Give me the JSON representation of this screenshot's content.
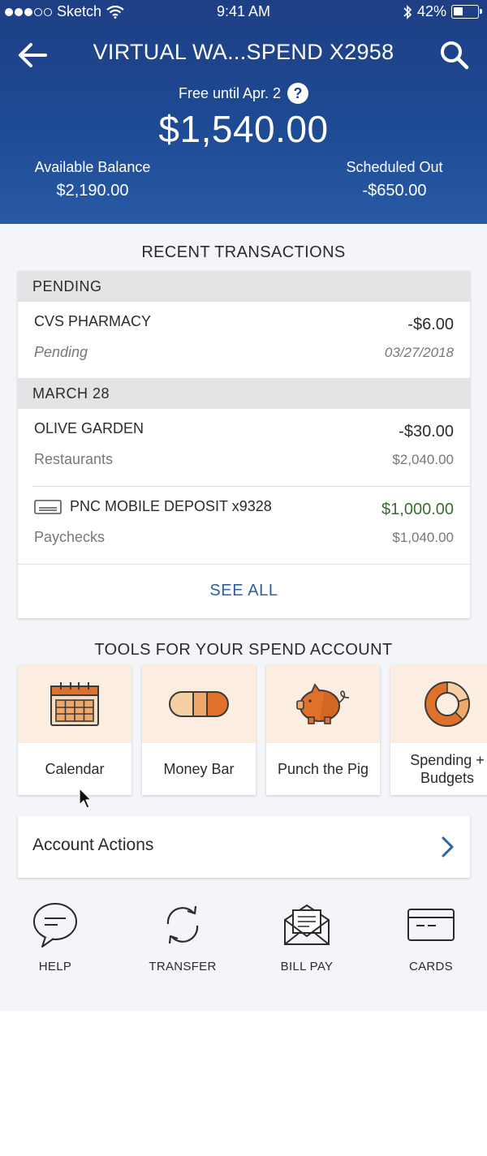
{
  "status_bar": {
    "carrier": "Sketch",
    "time": "9:41 AM",
    "battery": "42%",
    "battery_level": 0.42
  },
  "header": {
    "title": "VIRTUAL WA...SPEND X2958",
    "free_text": "Free until Apr. 2",
    "help_label": "?",
    "amount": "$1,540.00",
    "available_label": "Available Balance",
    "available_value": "$2,190.00",
    "scheduled_label": "Scheduled Out",
    "scheduled_value": "-$650.00"
  },
  "recent": {
    "title": "RECENT TRANSACTIONS",
    "groups": [
      {
        "header": "PENDING",
        "rows": [
          {
            "name": "CVS PHARMACY",
            "sub": "Pending",
            "amount": "-$6.00",
            "sub_right": "03/27/2018"
          }
        ]
      },
      {
        "header": "MARCH 28",
        "rows": [
          {
            "name": "OLIVE GARDEN",
            "sub": "Restaurants",
            "amount": "-$30.00",
            "sub_right": "$2,040.00"
          },
          {
            "name": "PNC MOBILE DEPOSIT x9328",
            "sub": "Paychecks",
            "amount": "$1,000.00",
            "sub_right": "$1,040.00"
          }
        ]
      }
    ],
    "see_all": "SEE ALL"
  },
  "tools": {
    "title": "TOOLS FOR YOUR SPEND ACCOUNT",
    "items": [
      {
        "label": "Calendar",
        "icon": "calendar-icon"
      },
      {
        "label": "Money Bar",
        "icon": "money-bar-icon"
      },
      {
        "label": "Punch the Pig",
        "icon": "piggy-bank-icon"
      },
      {
        "label": "Spending + Budgets",
        "icon": "donut-chart-icon"
      }
    ]
  },
  "account_actions": {
    "label": "Account Actions"
  },
  "quick_actions": [
    {
      "label": "HELP",
      "icon": "chat-bubble-icon"
    },
    {
      "label": "TRANSFER",
      "icon": "transfer-icon"
    },
    {
      "label": "BILL PAY",
      "icon": "envelope-icon"
    },
    {
      "label": "CARDS",
      "icon": "card-icon"
    }
  ],
  "colors": {
    "header_blue": "#1f3f85",
    "accent_orange": "#e0712a",
    "tool_icon_bg": "#fbeee0",
    "link_blue": "#2861a7",
    "positive_green": "#3d6b33"
  }
}
